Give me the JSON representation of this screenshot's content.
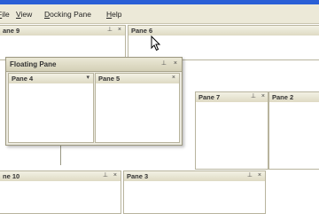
{
  "menubar": {
    "items": [
      {
        "prefix": "",
        "hotkey": "F",
        "rest": "ile"
      },
      {
        "prefix": "",
        "hotkey": "V",
        "rest": "iew"
      },
      {
        "prefix": "",
        "hotkey": "D",
        "rest": "ocking Pane"
      },
      {
        "prefix": "",
        "hotkey": "H",
        "rest": "elp"
      }
    ]
  },
  "panes": {
    "pane_9": {
      "title": "ane 9",
      "pin": "⊥",
      "close": "×"
    },
    "pane_6": {
      "title": "Pane 6"
    },
    "pane_7": {
      "title": "Pane 7",
      "pin": "⊥",
      "close": "×"
    },
    "pane_2": {
      "title": "Pane 2",
      "pin": "⊥",
      "close": "×"
    },
    "pane_10": {
      "title": "ne 10",
      "pin": "⊥",
      "close": "×"
    },
    "pane_3": {
      "title": "Pane 3",
      "pin": "⊥",
      "close": "×"
    }
  },
  "floating_pane": {
    "title": "Floating Pane",
    "pin": "⊥",
    "close": "×",
    "pane_4": {
      "title": "Pane 4",
      "dropdown": "▾"
    },
    "pane_5": {
      "title": "Pane 5",
      "close": "×"
    }
  },
  "icons": {
    "cursor": "arrow-cursor-icon"
  },
  "colors": {
    "window_title": "#2a5fd6",
    "chrome": "#ece9d8"
  }
}
